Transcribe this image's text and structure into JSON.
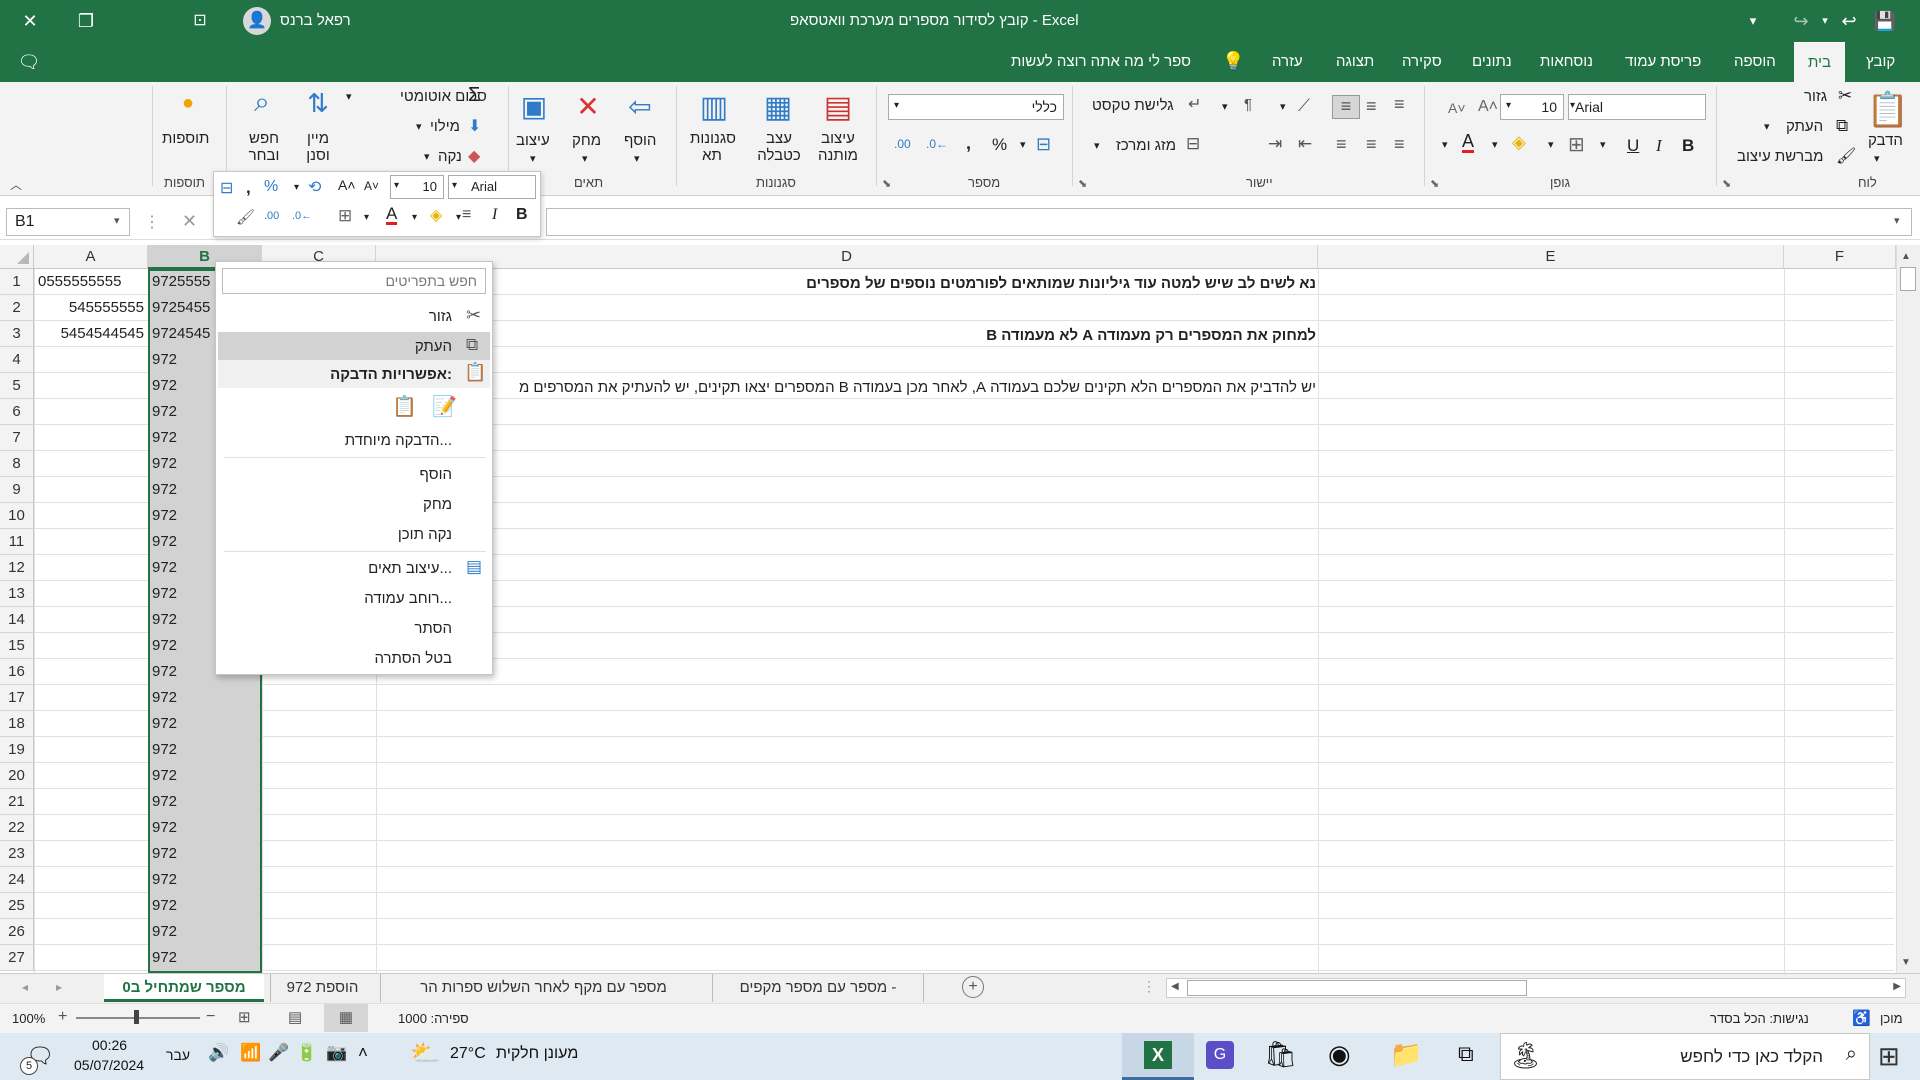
{
  "title_bar": {
    "title": "Excel  -  קובץ לסידור מספרים מערכת וואטסאפ",
    "user": "רפאל ברנס"
  },
  "tabs": [
    "קובץ",
    "בית",
    "הוספה",
    "פריסת עמוד",
    "נוסחאות",
    "נתונים",
    "סקירה",
    "תצוגה",
    "עזרה"
  ],
  "tell_me": "ספר לי מה אתה רוצה לעשות",
  "ribbon": {
    "clipboard": {
      "paste": "הדבק",
      "cut": "גזור",
      "copy": "העתק",
      "format_painter": "מברשת עיצוב",
      "group": "לוח"
    },
    "font": {
      "name": "Arial",
      "size": "10",
      "bold": "B",
      "italic": "I",
      "underline": "U",
      "group": "גופן"
    },
    "alignment": {
      "wrap": "גלישת טקסט",
      "merge": "מזג ומרכז",
      "group": "יישור"
    },
    "number": {
      "format": "כללי",
      "group": "מספר"
    },
    "styles": {
      "conditional": "עיצוב מותנה",
      "table": "עצב כטבלה",
      "cell_styles": "סגנונות תא",
      "group": "סגנונות"
    },
    "cells": {
      "insert": "הוסף",
      "delete": "מחק",
      "format": "עיצוב",
      "group": "תאים"
    },
    "editing": {
      "autosum": "סכום אוטומטי",
      "fill": "מילוי",
      "clear": "נקה",
      "sort": "מיין וסנן",
      "find": "חפש ובחר"
    },
    "addins": {
      "addins": "תוספות",
      "group": "תוספות"
    }
  },
  "formula_bar": {
    "name_box": "B1",
    "fx": "fx",
    "cancel": "✕"
  },
  "columns": [
    "A",
    "B",
    "C",
    "D",
    "E",
    "F"
  ],
  "rows": [
    "1",
    "2",
    "3",
    "4",
    "5",
    "6",
    "7",
    "8",
    "9",
    "10",
    "11",
    "12",
    "13",
    "14",
    "15",
    "16",
    "17",
    "18",
    "19",
    "20",
    "21",
    "22",
    "23",
    "24",
    "25",
    "26",
    "27"
  ],
  "col_a": [
    "0555555555",
    "545555555",
    "5454544545"
  ],
  "col_b": [
    "9725555",
    "9725455",
    "9724545",
    "972",
    "972",
    "972",
    "972",
    "972",
    "972",
    "972",
    "972",
    "972",
    "972",
    "972",
    "972",
    "972",
    "972",
    "972",
    "972",
    "972",
    "972",
    "972",
    "972",
    "972",
    "972",
    "972",
    "972"
  ],
  "d_cells": {
    "d1": "נא לשים לב שיש למטה עוד גיליונות שמותאים לפורמטים נוספים של מספרים",
    "d3": "למחוק את המספרים רק מעמודה A לא מעמודה B",
    "d5": "יש להדביק את המספרים הלא תקינים שלכם בעמודה A, לאחר מכן בעמודה B המספרים יצאו תקינים, יש להעתיק את המסרפים מ"
  },
  "context_menu": {
    "search": "חפש בתפריטים",
    "cut": "גזור",
    "copy": "העתק",
    "paste_options": "אפשרויות הדבקה:",
    "paste_special": "הדבקה מיוחדת...",
    "insert": "הוסף",
    "delete": "מחק",
    "clear": "נקה תוכן",
    "format_cells": "עיצוב תאים...",
    "column_width": "רוחב עמודה...",
    "hide": "הסתר",
    "unhide": "בטל הסתרה"
  },
  "mini_toolbar": {
    "font": "Arial",
    "size": "10",
    "bold": "B",
    "italic": "I",
    "percent": "%",
    "comma": ","
  },
  "sheet_tabs": [
    "מספר שמתחיל ב0",
    "הוספת 972",
    "מספר עם מקף לאחר השלוש ספרות הר",
    "מספר עם מספר מקפים -"
  ],
  "status": {
    "ready": "מוכן",
    "accessibility": "נגישות: הכל בסדר",
    "count": "ספירה: 1000",
    "zoom": "100%"
  },
  "taskbar": {
    "search": "הקלד כאן כדי לחפש",
    "weather_temp": "27°C",
    "weather_text": "מעונן חלקית",
    "lang": "עבר",
    "time": "00:26",
    "date": "05/07/2024",
    "notif_count": "5"
  },
  "colors": {
    "excel_green": "#217346",
    "selection": "#c6c6c6"
  }
}
